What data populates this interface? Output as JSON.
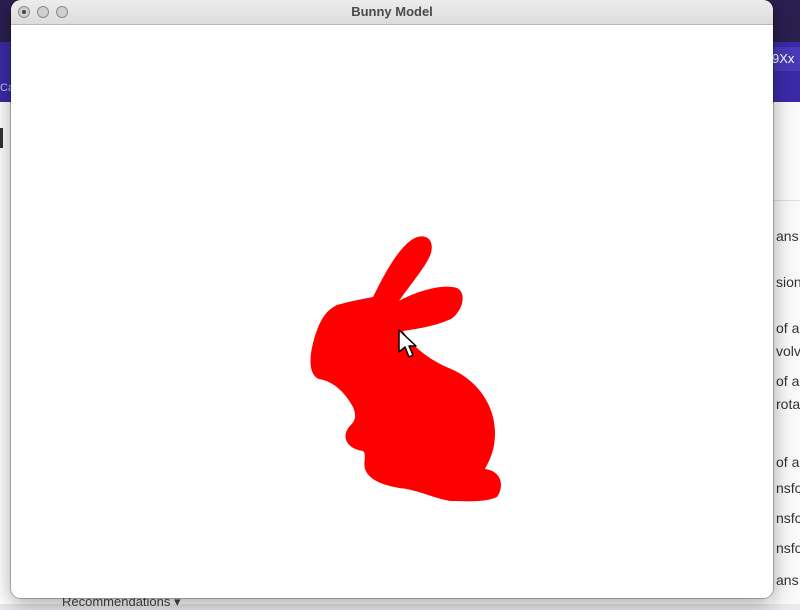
{
  "window": {
    "title": "Bunny Model",
    "model_color": "#ff0000",
    "background_color": "#ffffff"
  },
  "background_app": {
    "account_chip": "9Xx",
    "left_crumb": "Ca",
    "right_fragments": [
      "ans",
      "sion",
      "of a",
      "volve",
      "of a",
      "rota",
      "of a",
      "nsfo",
      "nsfo",
      "nsfo",
      "ans"
    ],
    "bottom_label": "Recommendations ▾",
    "topbar_color": "#2a1f4f",
    "navbar_color": "#3b2aa8"
  },
  "icons": {
    "close": "close-dot-icon",
    "minimize": "minimize-dot-icon",
    "maximize": "maximize-dot-icon",
    "cursor": "arrow-cursor-icon"
  }
}
